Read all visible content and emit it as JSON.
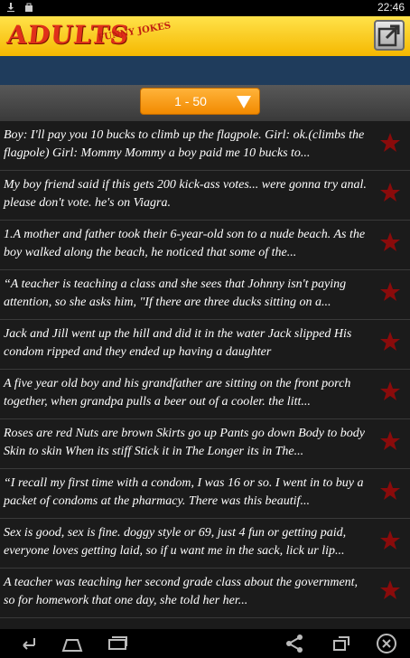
{
  "status": {
    "time": "22:46",
    "icons": [
      "download-icon",
      "bag-icon"
    ]
  },
  "header": {
    "logo_text": "ADULTS",
    "logo_sub": "FUNNY JOKES",
    "share_icon": "share-icon"
  },
  "range": {
    "label": "1 - 50"
  },
  "colors": {
    "accent": "#f5a300",
    "star": "#8a0b0b",
    "banner": "#1f3c5c"
  },
  "jokes": [
    {
      "text": "Boy: I'll pay you 10 bucks to climb up the flagpole. Girl: ok.(climbs the flagpole) Girl: Mommy Mommy a boy paid me 10 bucks to..."
    },
    {
      "text": "My boy friend said if this gets 200 kick-ass votes... were gonna try anal. please don't vote. he's on Viagra."
    },
    {
      "text": "1.A mother and father took their 6-year-old son to a nude beach. As the boy walked along the beach, he noticed that some of the..."
    },
    {
      "text": "“A teacher is teaching a class and she sees that Johnny isn't paying attention, so she asks him, \"If there are three ducks sitting on a..."
    },
    {
      "text": "Jack and Jill went up the hill and did it in the water Jack slipped His condom ripped and they ended up having a daughter"
    },
    {
      "text": "A five year old boy and his grandfather are sitting on the front porch together, when grandpa pulls a beer out of a cooler. the litt..."
    },
    {
      "text": "Roses are red Nuts are brown Skirts go up Pants go down Body to body Skin to skin When its stiff Stick it in The Longer its in The..."
    },
    {
      "text": "“I recall my first time with a condom, I was 16 or so. I went in to buy a packet of condoms at the pharmacy. There was this beautif..."
    },
    {
      "text": "Sex is good, sex is fine. doggy style or 69, just 4 fun or getting paid, everyone loves getting laid, so if u want me in the sack, lick ur lip..."
    },
    {
      "text": "A teacher was teaching her second grade class about the government, so for homework that one day, she told her her..."
    }
  ],
  "nav": [
    "back-icon",
    "home-icon",
    "recent-apps-icon",
    "share-icon",
    "screen-icon",
    "close-icon"
  ]
}
